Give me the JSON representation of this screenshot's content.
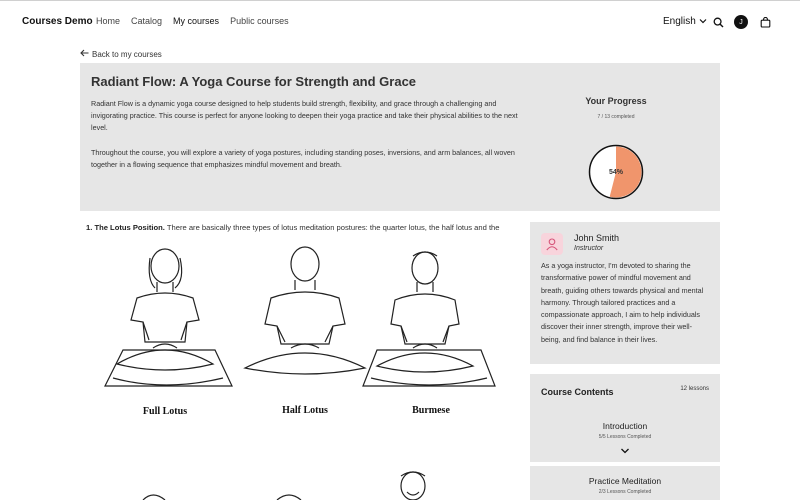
{
  "header": {
    "brand": "Courses Demo",
    "nav": [
      "Home",
      "Catalog",
      "My courses",
      "Public courses"
    ],
    "active_nav": "My courses",
    "language": "English",
    "avatar_initial": "J"
  },
  "back_link": "Back to my courses",
  "course": {
    "title": "Radiant Flow: A Yoga Course for Strength and Grace",
    "description_1": "Radiant Flow is a dynamic yoga course designed to help students build strength, flexibility, and grace through a challenging and invigorating practice. This course is perfect for anyone looking to deepen their yoga practice and take their physical abilities to the next level.",
    "description_2": "Throughout the course, you will explore a variety of yoga postures, including standing poses, inversions, and arm balances, all woven together in a flowing sequence that emphasizes mindful movement and breath."
  },
  "progress": {
    "title": "Your Progress",
    "summary": "7 / 13 completed",
    "percent_label": "54%",
    "fraction": 0.54,
    "fill_color": "#f0956c"
  },
  "lesson": {
    "heading": "1. The Lotus Position.",
    "text": " There are basically three types of lotus meditation postures: the quarter lotus, the half lotus and the",
    "figure_captions": [
      "Full Lotus",
      "Half Lotus",
      "Burmese"
    ]
  },
  "instructor": {
    "name": "John Smith",
    "role": "Instructor",
    "bio": "As a yoga instructor, I'm devoted to sharing the transformative power of mindful movement and breath, guiding others towards physical and mental harmony. Through tailored practices and a compassionate approach, I aim to help individuals discover their inner strength, improve their well-being, and find balance in their lives."
  },
  "contents": {
    "title": "Course Contents",
    "count": "12 lessons",
    "modules": [
      {
        "title": "Introduction",
        "status": "5/5 Lessons Completed"
      },
      {
        "title": "Practice Meditation",
        "status": "2/3 Lessons Completed"
      }
    ]
  }
}
